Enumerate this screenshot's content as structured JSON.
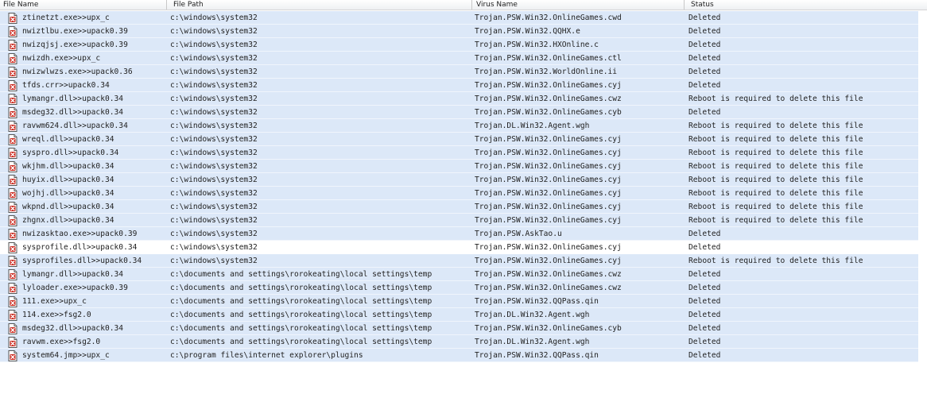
{
  "columns": {
    "file_name": "File Name",
    "file_path": "File Path",
    "virus_name": "Virus Name",
    "status": "Status"
  },
  "rows": [
    {
      "name": "ztinetzt.exe>>upx_c",
      "path": "c:\\windows\\system32",
      "virus": "Trojan.PSW.Win32.OnlineGames.cwd",
      "status": "Deleted"
    },
    {
      "name": "nwiztlbu.exe>>upack0.39",
      "path": "c:\\windows\\system32",
      "virus": "Trojan.PSW.Win32.QQHX.e",
      "status": "Deleted"
    },
    {
      "name": "nwizqjsj.exe>>upack0.39",
      "path": "c:\\windows\\system32",
      "virus": "Trojan.PSW.Win32.HXOnline.c",
      "status": "Deleted"
    },
    {
      "name": "nwizdh.exe>>upx_c",
      "path": "c:\\windows\\system32",
      "virus": "Trojan.PSW.Win32.OnlineGames.ctl",
      "status": "Deleted"
    },
    {
      "name": "nwizwlwzs.exe>>upack0.36",
      "path": "c:\\windows\\system32",
      "virus": "Trojan.PSW.Win32.WorldOnline.ii",
      "status": "Deleted"
    },
    {
      "name": "tfds.crr>>upack0.34",
      "path": "c:\\windows\\system32",
      "virus": "Trojan.PSW.Win32.OnlineGames.cyj",
      "status": "Deleted"
    },
    {
      "name": "lymangr.dll>>upack0.34",
      "path": "c:\\windows\\system32",
      "virus": "Trojan.PSW.Win32.OnlineGames.cwz",
      "status": "Reboot is required to delete this file"
    },
    {
      "name": "msdeg32.dll>>upack0.34",
      "path": "c:\\windows\\system32",
      "virus": "Trojan.PSW.Win32.OnlineGames.cyb",
      "status": "Deleted"
    },
    {
      "name": "ravwm624.dll>>upack0.34",
      "path": "c:\\windows\\system32",
      "virus": "Trojan.DL.Win32.Agent.wgh",
      "status": "Reboot is required to delete this file"
    },
    {
      "name": "wreql.dll>>upack0.34",
      "path": "c:\\windows\\system32",
      "virus": "Trojan.PSW.Win32.OnlineGames.cyj",
      "status": "Reboot is required to delete this file"
    },
    {
      "name": "syspro.dll>>upack0.34",
      "path": "c:\\windows\\system32",
      "virus": "Trojan.PSW.Win32.OnlineGames.cyj",
      "status": "Reboot is required to delete this file"
    },
    {
      "name": "wkjhm.dll>>upack0.34",
      "path": "c:\\windows\\system32",
      "virus": "Trojan.PSW.Win32.OnlineGames.cyj",
      "status": "Reboot is required to delete this file"
    },
    {
      "name": "huyix.dll>>upack0.34",
      "path": "c:\\windows\\system32",
      "virus": "Trojan.PSW.Win32.OnlineGames.cyj",
      "status": "Reboot is required to delete this file"
    },
    {
      "name": "wojhj.dll>>upack0.34",
      "path": "c:\\windows\\system32",
      "virus": "Trojan.PSW.Win32.OnlineGames.cyj",
      "status": "Reboot is required to delete this file"
    },
    {
      "name": "wkpnd.dll>>upack0.34",
      "path": "c:\\windows\\system32",
      "virus": "Trojan.PSW.Win32.OnlineGames.cyj",
      "status": "Reboot is required to delete this file"
    },
    {
      "name": "zhgnx.dll>>upack0.34",
      "path": "c:\\windows\\system32",
      "virus": "Trojan.PSW.Win32.OnlineGames.cyj",
      "status": "Reboot is required to delete this file"
    },
    {
      "name": "nwizasktao.exe>>upack0.39",
      "path": "c:\\windows\\system32",
      "virus": "Trojan.PSW.AskTao.u",
      "status": "Deleted"
    },
    {
      "name": "sysprofile.dll>>upack0.34",
      "path": "c:\\windows\\system32",
      "virus": "Trojan.PSW.Win32.OnlineGames.cyj",
      "status": "Deleted",
      "highlighted": false
    },
    {
      "name": "sysprofiles.dll>>upack0.34",
      "path": "c:\\windows\\system32",
      "virus": "Trojan.PSW.Win32.OnlineGames.cyj",
      "status": "Reboot is required to delete this file"
    },
    {
      "name": "lymangr.dll>>upack0.34",
      "path": "c:\\documents and settings\\rorokeating\\local settings\\temp",
      "virus": "Trojan.PSW.Win32.OnlineGames.cwz",
      "status": "Deleted"
    },
    {
      "name": "lyloader.exe>>upack0.39",
      "path": "c:\\documents and settings\\rorokeating\\local settings\\temp",
      "virus": "Trojan.PSW.Win32.OnlineGames.cwz",
      "status": "Deleted"
    },
    {
      "name": "111.exe>>upx_c",
      "path": "c:\\documents and settings\\rorokeating\\local settings\\temp",
      "virus": "Trojan.PSW.Win32.QQPass.qin",
      "status": "Deleted"
    },
    {
      "name": "114.exe>>fsg2.0",
      "path": "c:\\documents and settings\\rorokeating\\local settings\\temp",
      "virus": "Trojan.DL.Win32.Agent.wgh",
      "status": "Deleted"
    },
    {
      "name": "msdeg32.dll>>upack0.34",
      "path": "c:\\documents and settings\\rorokeating\\local settings\\temp",
      "virus": "Trojan.PSW.Win32.OnlineGames.cyb",
      "status": "Deleted"
    },
    {
      "name": "ravwm.exe>>fsg2.0",
      "path": "c:\\documents and settings\\rorokeating\\local settings\\temp",
      "virus": "Trojan.DL.Win32.Agent.wgh",
      "status": "Deleted"
    },
    {
      "name": "system64.jmp>>upx_c",
      "path": "c:\\program files\\internet explorer\\plugins",
      "virus": "Trojan.PSW.Win32.QQPass.qin",
      "status": "Deleted"
    }
  ],
  "icons": {
    "row_icon": "infected-file-icon"
  },
  "colors": {
    "row_bg": "#dce8f8",
    "row_plain_bg": "#ffffff",
    "icon_red": "#c8281e"
  }
}
